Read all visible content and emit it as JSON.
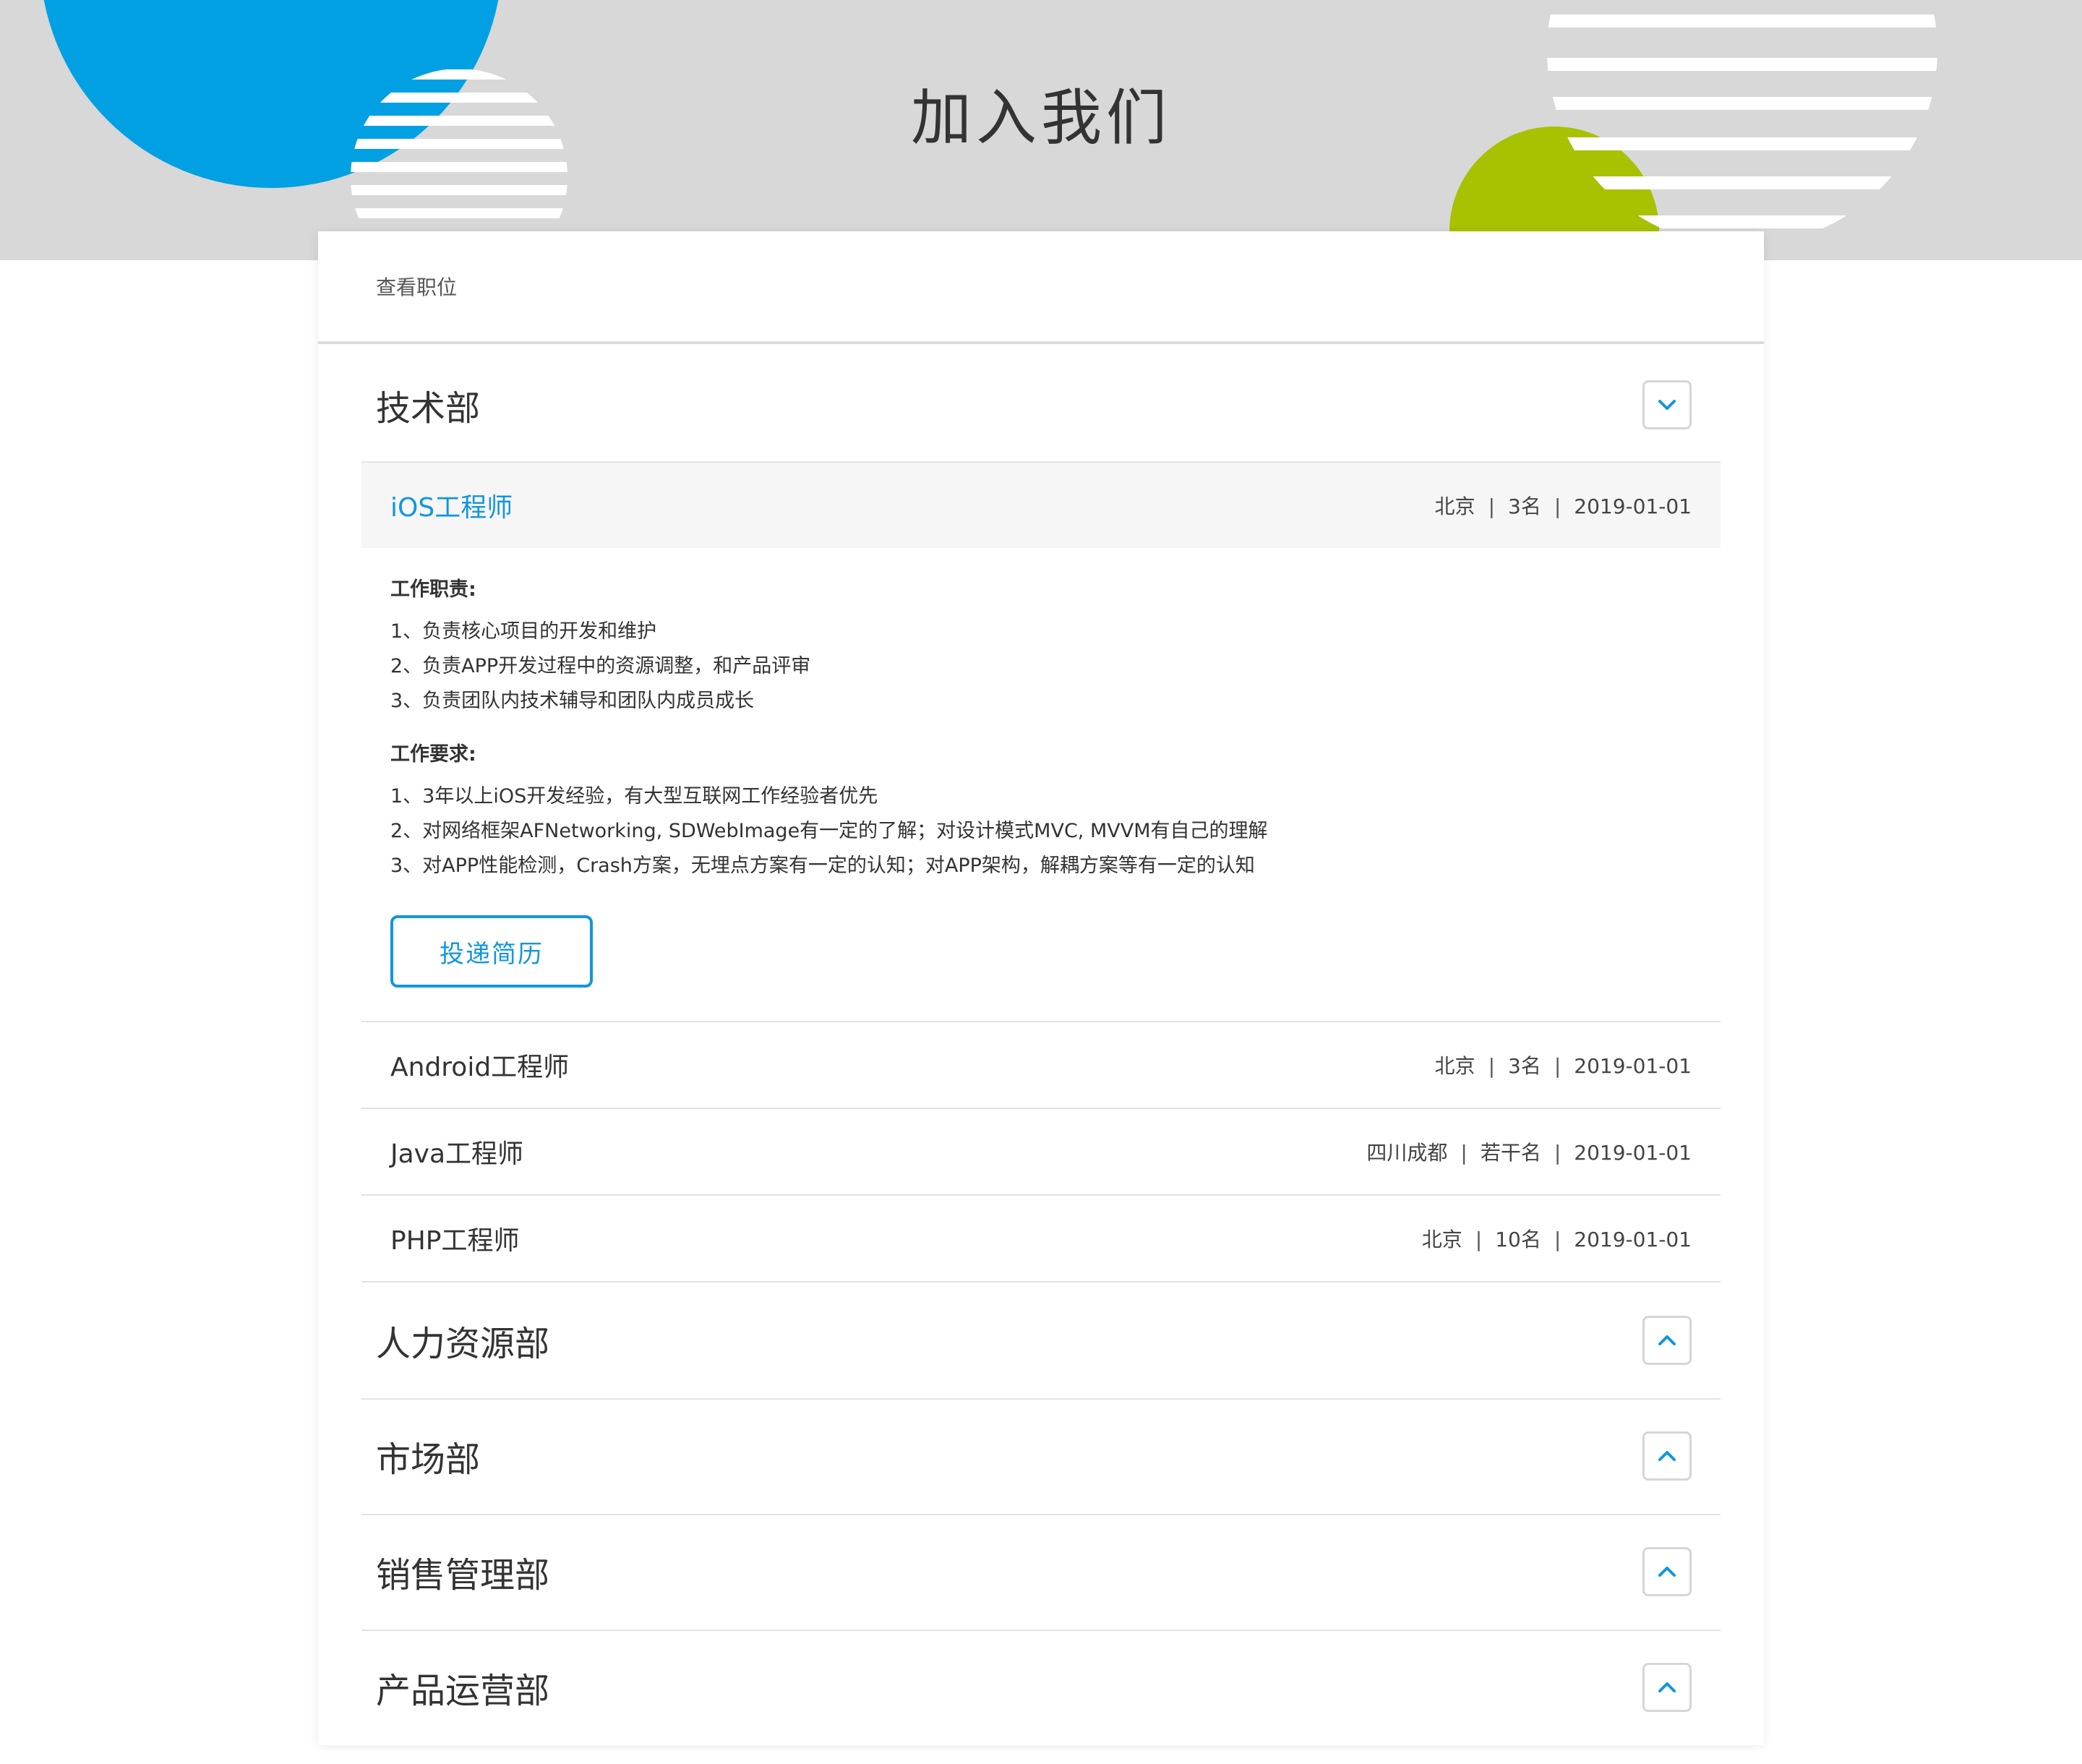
{
  "banner": {
    "title": "加入我们"
  },
  "card": {
    "header": "查看职位"
  },
  "colors": {
    "accent": "#1296db",
    "banner_bg": "#d8d8d8",
    "circle_blue": "#00a0e3",
    "circle_green": "#a8c100"
  },
  "departments": [
    {
      "name": "技术部",
      "state": "expanded",
      "toggle_icon": "chevron-down-icon"
    },
    {
      "name": "人力资源部",
      "state": "collapsed",
      "toggle_icon": "chevron-up-icon"
    },
    {
      "name": "市场部",
      "state": "collapsed",
      "toggle_icon": "chevron-up-icon"
    },
    {
      "name": "销售管理部",
      "state": "collapsed",
      "toggle_icon": "chevron-up-icon"
    },
    {
      "name": "产品运营部",
      "state": "collapsed",
      "toggle_icon": "chevron-up-icon"
    }
  ],
  "separator": "|",
  "jobs": [
    {
      "title": "iOS工程师",
      "location": "北京",
      "count": "3名",
      "date": "2019-01-01",
      "selected": true
    },
    {
      "title": "Android工程师",
      "location": "北京",
      "count": "3名",
      "date": "2019-01-01"
    },
    {
      "title": "Java工程师",
      "location": "四川成都",
      "count": "若干名",
      "date": "2019-01-01"
    },
    {
      "title": "PHP工程师",
      "location": "北京",
      "count": "10名",
      "date": "2019-01-01"
    }
  ],
  "job_detail": {
    "duties_title": "工作职责:",
    "duties": [
      "1、负责核心项目的开发和维护",
      "2、负责APP开发过程中的资源调整，和产品评审",
      "3、负责团队内技术辅导和团队内成员成长"
    ],
    "requirements_title": "工作要求:",
    "requirements": [
      "1、3年以上iOS开发经验，有大型互联网工作经验者优先",
      "2、对网络框架AFNetworking, SDWebImage有一定的了解；对设计模式MVC, MVVM有自己的理解",
      "3、对APP性能检测，Crash方案，无埋点方案有一定的认知；对APP架构，解耦方案等有一定的认知"
    ],
    "apply_label": "投递简历"
  }
}
